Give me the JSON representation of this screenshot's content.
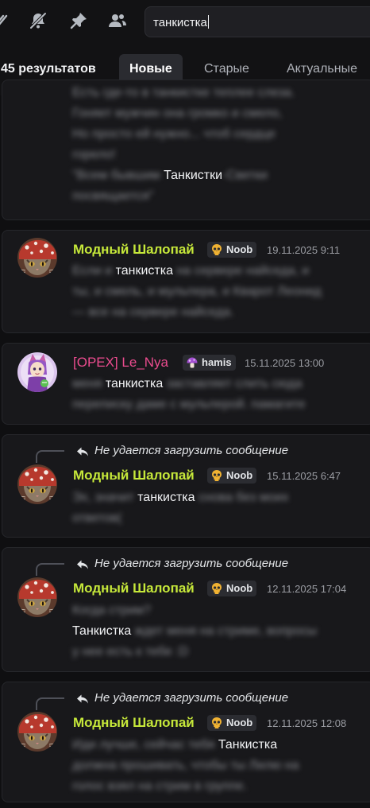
{
  "toolbar": {
    "icons": [
      "threads-icon",
      "bell-muted-icon",
      "pin-icon",
      "members-icon"
    ],
    "search": {
      "value": "танкистка"
    }
  },
  "results": {
    "count_label": "45 результатов",
    "tabs": [
      {
        "label": "Новые",
        "active": true
      },
      {
        "label": "Старые",
        "active": false
      },
      {
        "label": "Актуальные",
        "active": false
      }
    ]
  },
  "messages": [
    {
      "partial": true,
      "lines": [
        [
          {
            "t": "Есть где-то в танкистке теплее слеза.",
            "b": true
          }
        ],
        [
          {
            "t": "Гоняет мужчин она громко и смело,",
            "b": true
          }
        ],
        [
          {
            "t": "Но просто ей нужно... чтоб сердце",
            "b": true
          }
        ],
        [
          {
            "t": "горело!",
            "b": true
          }
        ],
        [
          {
            "t": "\"Всем бывшим ",
            "b": true
          },
          {
            "t": "Танкистки",
            "b": false
          },
          {
            "t": "-Светки",
            "b": true
          }
        ],
        [
          {
            "t": "посвящается\"",
            "b": true
          }
        ]
      ]
    },
    {
      "author": "Модный Шалопай",
      "author_color": "#c6e83a",
      "badge": "Noob",
      "timestamp": "19.11.2025 9:11",
      "lines": [
        [
          {
            "t": "Если и ",
            "b": true
          },
          {
            "t": "танкистка",
            "b": false
          },
          {
            "t": " на сервере найседа, и",
            "b": true
          }
        ],
        [
          {
            "t": "ты, и смель, и мульпера, и Кварот Леонид",
            "b": true
          }
        ],
        [
          {
            "t": "— все на сервере найседа.",
            "b": true
          }
        ]
      ]
    },
    {
      "author": "[OPEX] Le_Nya",
      "author_color": "#ec4c8f",
      "badge": "hamis",
      "timestamp": "15.11.2025 13:00",
      "lines": [
        [
          {
            "t": "меня ",
            "b": true
          },
          {
            "t": "танкистка",
            "b": false
          },
          {
            "t": " заставляет слить сюда",
            "b": true
          }
        ],
        [
          {
            "t": "переписку даме с мульперой. памагите",
            "b": true
          }
        ]
      ]
    },
    {
      "reply": "Не удается загрузить сообщение",
      "author": "Модный Шалопай",
      "author_color": "#c6e83a",
      "badge": "Noob",
      "timestamp": "15.11.2025 6:47",
      "lines": [
        [
          {
            "t": "Эх, значит ",
            "b": true
          },
          {
            "t": "танкистка",
            "b": false
          },
          {
            "t": " снова без моих",
            "b": true
          }
        ],
        [
          {
            "t": "ответов(",
            "b": true
          }
        ]
      ]
    },
    {
      "reply": "Не удается загрузить сообщение",
      "author": "Модный Шалопай",
      "author_color": "#c6e83a",
      "badge": "Noob",
      "timestamp": "12.11.2025 17:04",
      "lines": [
        [
          {
            "t": "Когда стрим?",
            "b": true
          }
        ],
        [
          {
            "t": "Танкистка",
            "b": false
          },
          {
            "t": " ждет меня на стриме, вопросы",
            "b": true
          }
        ],
        [
          {
            "t": "у нее есть к тебе :D",
            "b": true
          }
        ]
      ]
    },
    {
      "reply": "Не удается загрузить сообщение",
      "author": "Модный Шалопай",
      "author_color": "#c6e83a",
      "badge": "Noob",
      "timestamp": "12.11.2025 12:08",
      "lines": [
        [
          {
            "t": "Иди лучше, сейчас тебя ",
            "b": true
          },
          {
            "t": "Танкистка",
            "b": false
          }
        ],
        [
          {
            "t": "должна прошивать, чтобы ты Лилю на",
            "b": true
          }
        ],
        [
          {
            "t": "голос взял на стрим в группе.",
            "b": true
          }
        ]
      ]
    }
  ]
}
